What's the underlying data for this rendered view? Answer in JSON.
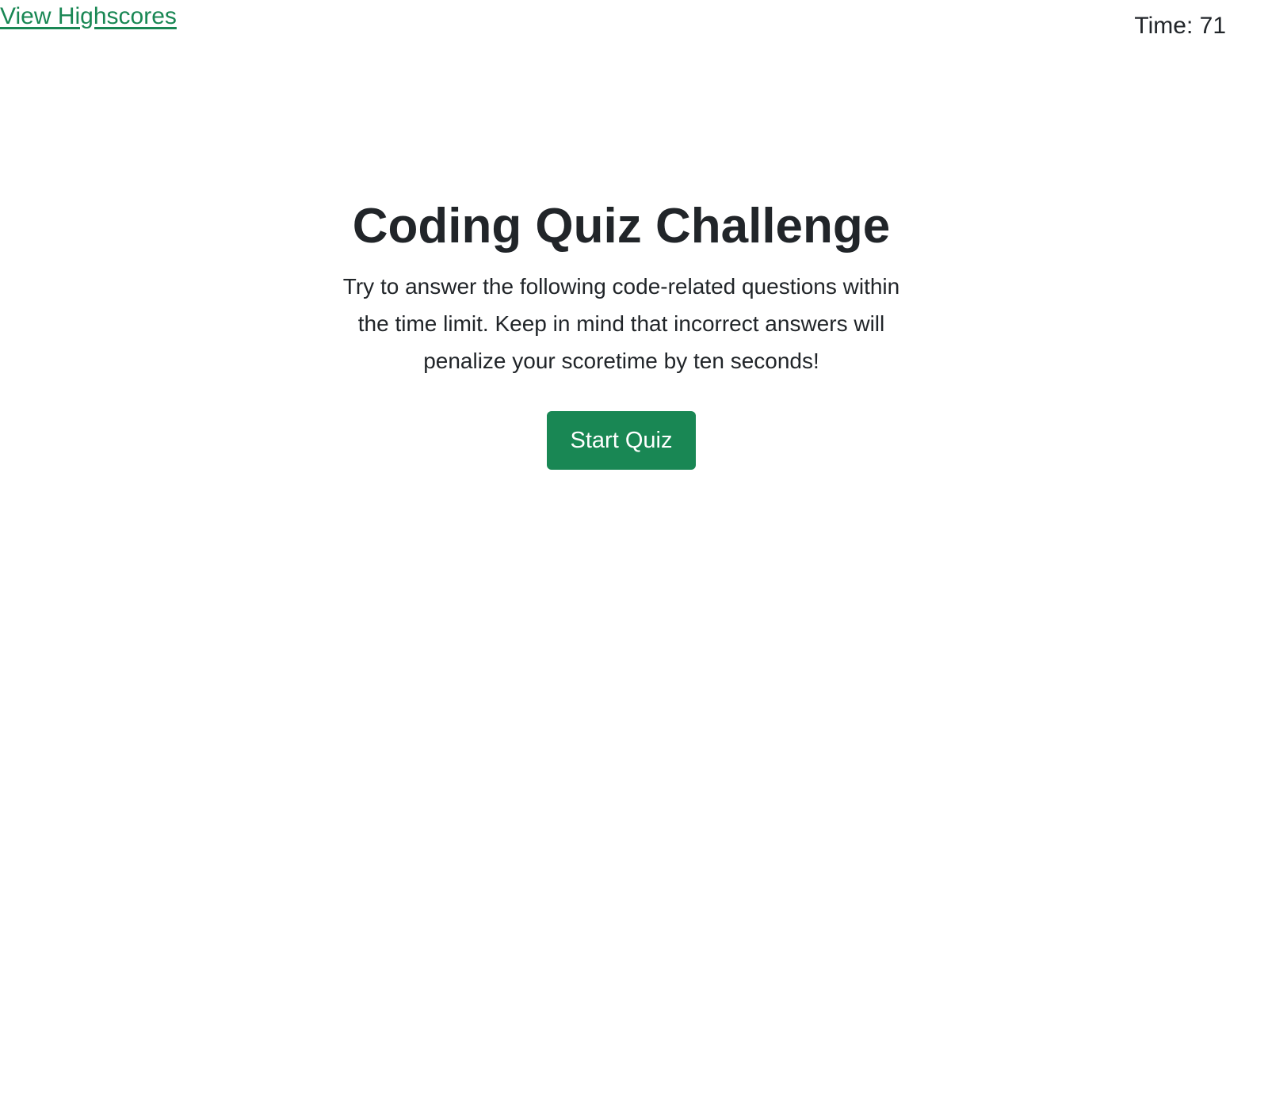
{
  "header": {
    "highscores_link": "View Highscores",
    "timer_label": "Time: 71"
  },
  "main": {
    "title": "Coding Quiz Challenge",
    "description": "Try to answer the following code-related questions within the time limit. Keep in mind that incorrect answers will penalize your scoretime by ten seconds!",
    "start_button": "Start Quiz"
  },
  "colors": {
    "accent": "#198754",
    "text": "#212529"
  }
}
